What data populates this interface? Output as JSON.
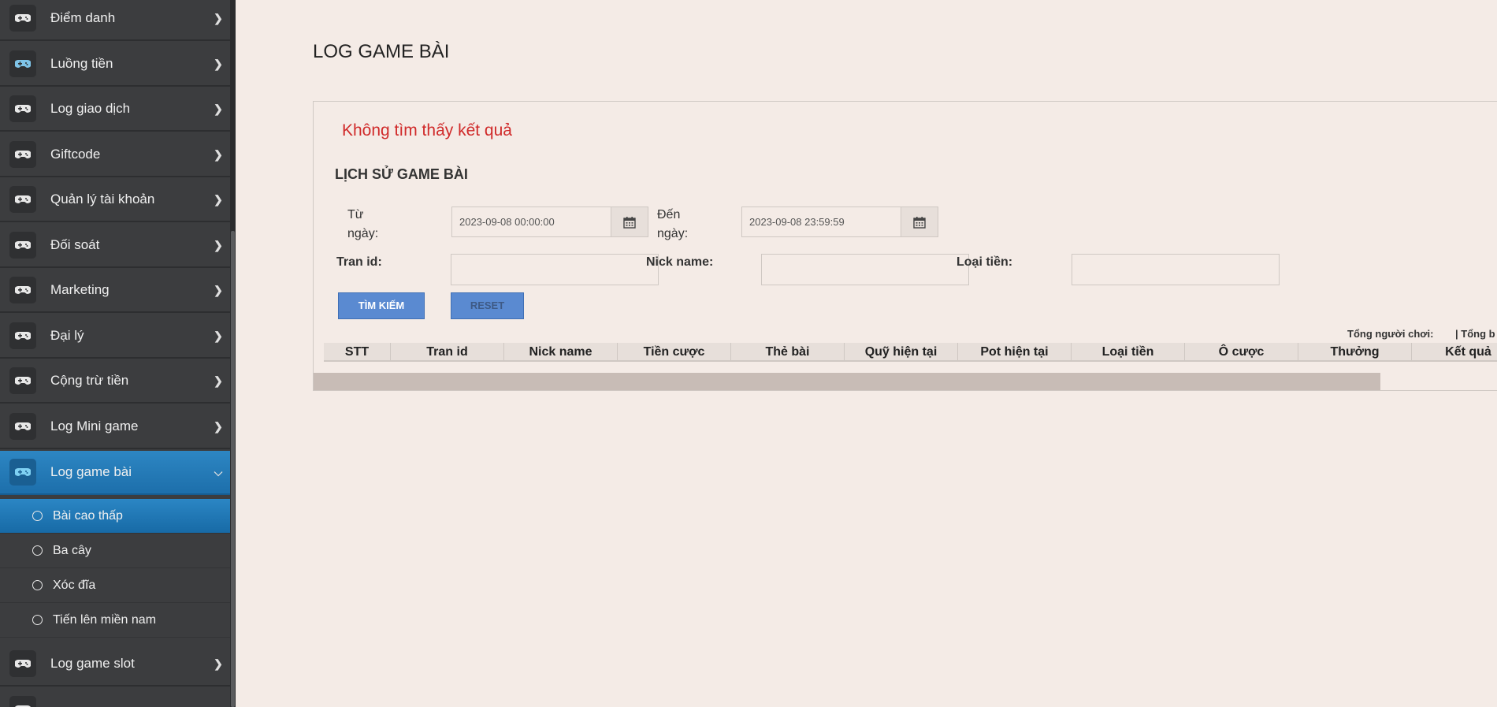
{
  "sidebar": {
    "items": [
      {
        "label": "Điểm danh"
      },
      {
        "label": "Luồng tiền"
      },
      {
        "label": "Log giao dịch"
      },
      {
        "label": "Giftcode"
      },
      {
        "label": "Quản lý tài khoản"
      },
      {
        "label": "Đối soát"
      },
      {
        "label": "Marketing"
      },
      {
        "label": "Đại lý"
      },
      {
        "label": "Cộng trừ tiền"
      },
      {
        "label": "Log Mini game"
      },
      {
        "label": "Log game bài"
      },
      {
        "label": "Log game slot"
      }
    ],
    "active_item": "Log game bài",
    "sub_items": [
      {
        "label": "Bài cao thấp"
      },
      {
        "label": "Ba cây"
      },
      {
        "label": "Xóc đĩa"
      },
      {
        "label": "Tiến lên miền nam"
      }
    ],
    "active_sub_item": "Bài cao thấp",
    "icon": "gamepad-icon",
    "accent_color": "#1f78b8"
  },
  "main": {
    "page_title": "LOG GAME BÀI",
    "no_result": "Không tìm thấy kết quả",
    "section_title": "LỊCH SỬ GAME BÀI",
    "filters": {
      "from_label_1": "Từ",
      "from_label_2": "ngày:",
      "from_value": "2023-09-08 00:00:00",
      "to_label_1": "Đến",
      "to_label_2": "ngày:",
      "to_value": "2023-09-08 23:59:59",
      "tran_id_label": "Tran id:",
      "tran_id_value": "",
      "nick_name_label": "Nick name:",
      "nick_name_value": "",
      "money_type_label": "Loại tiền:",
      "money_type_value": ""
    },
    "buttons": {
      "search": "TÌM KIẾM",
      "reset": "RESET"
    },
    "totals": {
      "players": "Tổng người chơi:",
      "second": "| Tổng b"
    },
    "table": {
      "columns": [
        "STT",
        "Tran id",
        "Nick name",
        "Tiền cược",
        "Thẻ bài",
        "Quỹ hiện tại",
        "Pot hiện tại",
        "Loại tiền",
        "Ô cược",
        "Thưởng",
        "Kết quả"
      ],
      "rows": []
    },
    "error_color": "#d02a2a"
  }
}
